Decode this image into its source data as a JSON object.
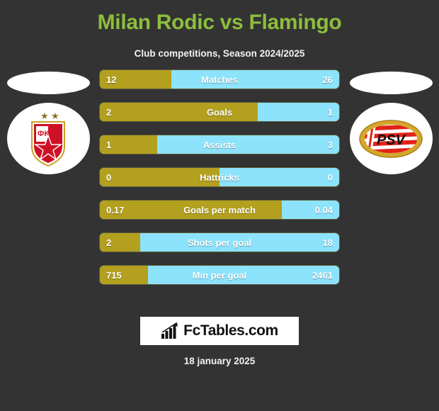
{
  "header": {
    "title": "Milan Rodic vs Flamingo",
    "subtitle": "Club competitions, Season 2024/2025",
    "title_color": "#8dbe3d"
  },
  "theme": {
    "background": "#333333",
    "home_color": "#b3a01e",
    "away_color": "#8ce3fb",
    "text_color": "#ffffff"
  },
  "crests": {
    "left": {
      "name": "crvena-zvezda-crest",
      "abbr": "ФК",
      "stars": "★ ★"
    },
    "right": {
      "name": "psv-eindhoven-crest",
      "abbr": "PSV"
    }
  },
  "chart_data": {
    "type": "bar",
    "title": "Milan Rodic vs Flamingo",
    "subtitle": "Club competitions, Season 2024/2025",
    "orientation": "horizontal-diverging",
    "series": [
      {
        "name": "Milan Rodic",
        "side": "home",
        "color": "#b3a01e"
      },
      {
        "name": "Flamingo",
        "side": "away",
        "color": "#8ce3fb"
      }
    ],
    "categories": [
      "Matches",
      "Goals",
      "Assists",
      "Hattricks",
      "Goals per match",
      "Shots per goal",
      "Min per goal"
    ],
    "rows": [
      {
        "label": "Matches",
        "home": "12",
        "away": "26",
        "home_pct": 30
      },
      {
        "label": "Goals",
        "home": "2",
        "away": "1",
        "home_pct": 66
      },
      {
        "label": "Assists",
        "home": "1",
        "away": "3",
        "home_pct": 24
      },
      {
        "label": "Hattricks",
        "home": "0",
        "away": "0",
        "home_pct": 50
      },
      {
        "label": "Goals per match",
        "home": "0.17",
        "away": "0.04",
        "home_pct": 76
      },
      {
        "label": "Shots per goal",
        "home": "2",
        "away": "18",
        "home_pct": 17
      },
      {
        "label": "Min per goal",
        "home": "715",
        "away": "2461",
        "home_pct": 20
      }
    ]
  },
  "footer": {
    "brand": "FcTables.com",
    "brand_icon": "bar-chart-arrow-icon",
    "date": "18 january 2025"
  }
}
